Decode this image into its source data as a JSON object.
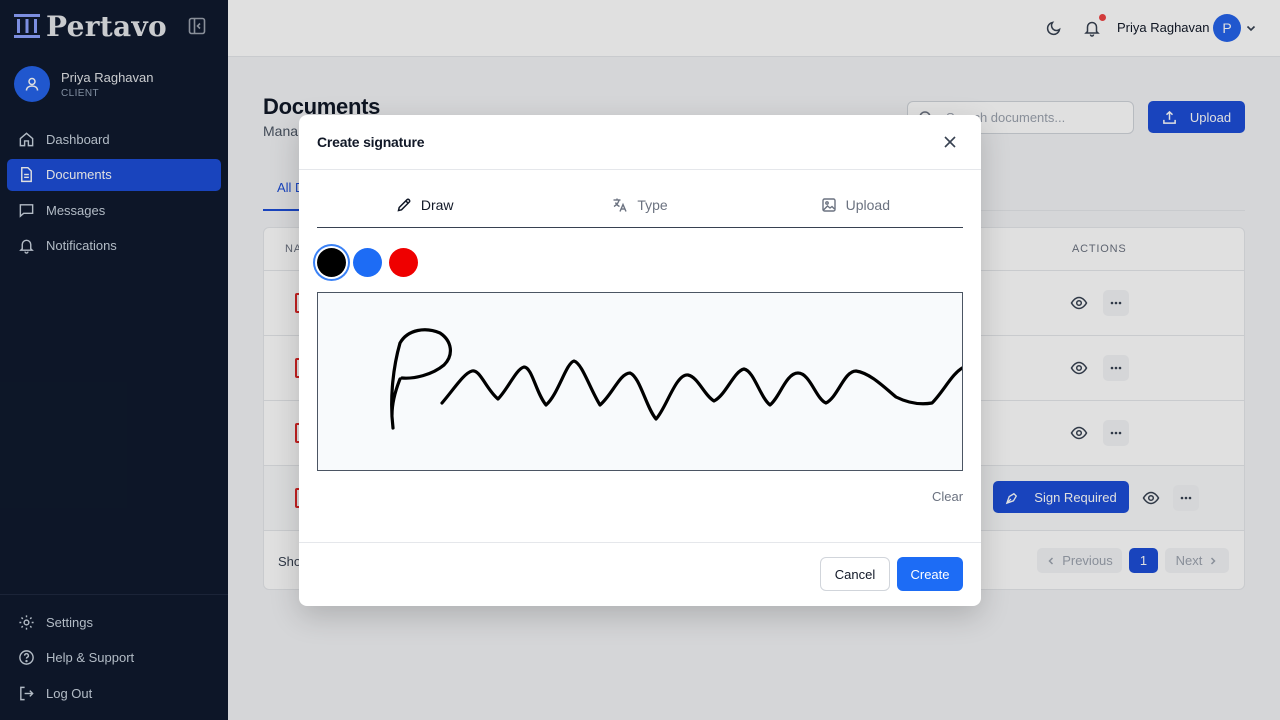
{
  "brand": {
    "name": "Pertavo"
  },
  "sidebar": {
    "user": {
      "name": "Priya Raghavan",
      "role": "CLIENT"
    },
    "items": [
      {
        "label": "Dashboard",
        "icon": "home-icon"
      },
      {
        "label": "Documents",
        "icon": "document-icon",
        "active": true
      },
      {
        "label": "Messages",
        "icon": "message-icon"
      },
      {
        "label": "Notifications",
        "icon": "bell-icon"
      }
    ],
    "bottom_items": [
      {
        "label": "Settings",
        "icon": "gear-icon"
      },
      {
        "label": "Help & Support",
        "icon": "help-icon"
      },
      {
        "label": "Log Out",
        "icon": "logout-icon"
      }
    ]
  },
  "topbar": {
    "user_name": "Priya Raghavan",
    "avatar_initial": "P"
  },
  "main": {
    "title": "Documents",
    "subtitle": "Mana",
    "search_placeholder": "Search documents...",
    "upload_label": "Upload",
    "tab_all": "All D",
    "table": {
      "col_name": "NA",
      "col_actions": "ACTIONS",
      "sign_required_label": "Sign Required"
    },
    "footer_show": "Sho",
    "pagination": {
      "previous": "Previous",
      "page": "1",
      "next": "Next"
    }
  },
  "modal": {
    "title": "Create signature",
    "tabs": [
      {
        "label": "Draw",
        "icon": "pencil-icon",
        "active": true
      },
      {
        "label": "Type",
        "icon": "translate-icon"
      },
      {
        "label": "Upload",
        "icon": "image-icon"
      }
    ],
    "colors": [
      "#000000",
      "#1d6cf5",
      "#ef0000"
    ],
    "selected_color": "#000000",
    "clear_label": "Clear",
    "cancel_label": "Cancel",
    "create_label": "Create"
  },
  "colors": {
    "accent": "#1d4ed8",
    "sidebar_bg": "#0f1a2e"
  }
}
